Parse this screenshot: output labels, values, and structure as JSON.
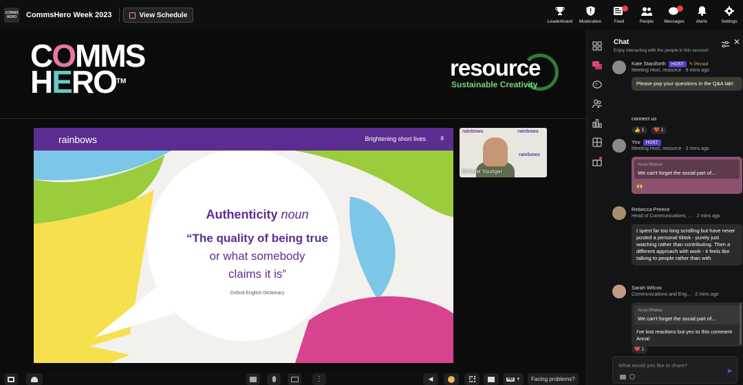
{
  "header": {
    "logo_text": "COMMS HERO",
    "event_title": "CommsHero Week 2023",
    "schedule_label": "View Schedule",
    "nav": [
      {
        "label": "Leaderboard",
        "icon": "trophy-icon",
        "badge": false
      },
      {
        "label": "Moderation",
        "icon": "shield-icon",
        "badge": false
      },
      {
        "label": "Feed",
        "icon": "feed-icon",
        "badge": true
      },
      {
        "label": "People",
        "icon": "people-icon",
        "badge": false
      },
      {
        "label": "Messages",
        "icon": "messages-icon",
        "badge": true
      },
      {
        "label": "Alerts",
        "icon": "bell-icon",
        "badge": false
      },
      {
        "label": "Settings",
        "icon": "gear-icon",
        "badge": false
      }
    ]
  },
  "banner": {
    "comms_hero_logo": "COMMS HERO",
    "resource_logo": "resource",
    "resource_tagline": "Sustainable Creativity"
  },
  "slide": {
    "brand": "rainbows",
    "tagline": "Brightening short lives",
    "number": "8",
    "heading_word": "Authenticity",
    "heading_type": "noun",
    "quote_line1": "“The quality of being true",
    "quote_line2": "or what somebody",
    "quote_line3": "claims it is”",
    "source": "Oxford English Dictionary",
    "colors": {
      "purple": "#5c2d91",
      "green": "#9bcc3c",
      "yellow": "#f7e04e",
      "blue": "#7cc7e8",
      "pink": "#d8438f"
    }
  },
  "speaker": {
    "name": "Michael Younger",
    "wall_text": "rainbows"
  },
  "bottombar": {
    "facing_problems": "Facing problems?",
    "quality": "HD"
  },
  "chat": {
    "title": "Chat",
    "subtitle": "Enjoy interacting with the people in this session!",
    "input_placeholder": "What would you like to share?",
    "messages": [
      {
        "name": "Kate Staniforth",
        "badge": "HOST",
        "pinned": "Pinned",
        "role": "Meeting Host, resource",
        "time": "8 mins ago",
        "text": "Please pop your questions in the Q&A tab!"
      },
      {
        "fragment": "connect us",
        "reactions": [
          "👍 1",
          "❤️ 1"
        ]
      },
      {
        "name": "You",
        "badge": "HOST",
        "role": "Meeting Host, resource",
        "time": "3 mins ago",
        "quote_name": "Anna Whelan",
        "quote_text": "We can't forget the social part of...",
        "text": "🙌"
      },
      {
        "name": "Rebecca Preece",
        "role": "Head of Communications, ...",
        "time": "2 mins ago",
        "text": "I spent far too long scrolling but have never posted a personal tiktok - purely just watching rather than contributing. Then a different approach with work - it feels like talking to people rather than with."
      },
      {
        "name": "Sarah Wilcox",
        "role": "Communications and Eng...",
        "time": "2 mins ago",
        "quote_name": "Anna Whelan",
        "quote_text": "We can't forget the social part of...",
        "text": "I've lost reactions but yes to this comment Anna!",
        "reactions": [
          "❤️ 1"
        ]
      }
    ]
  }
}
